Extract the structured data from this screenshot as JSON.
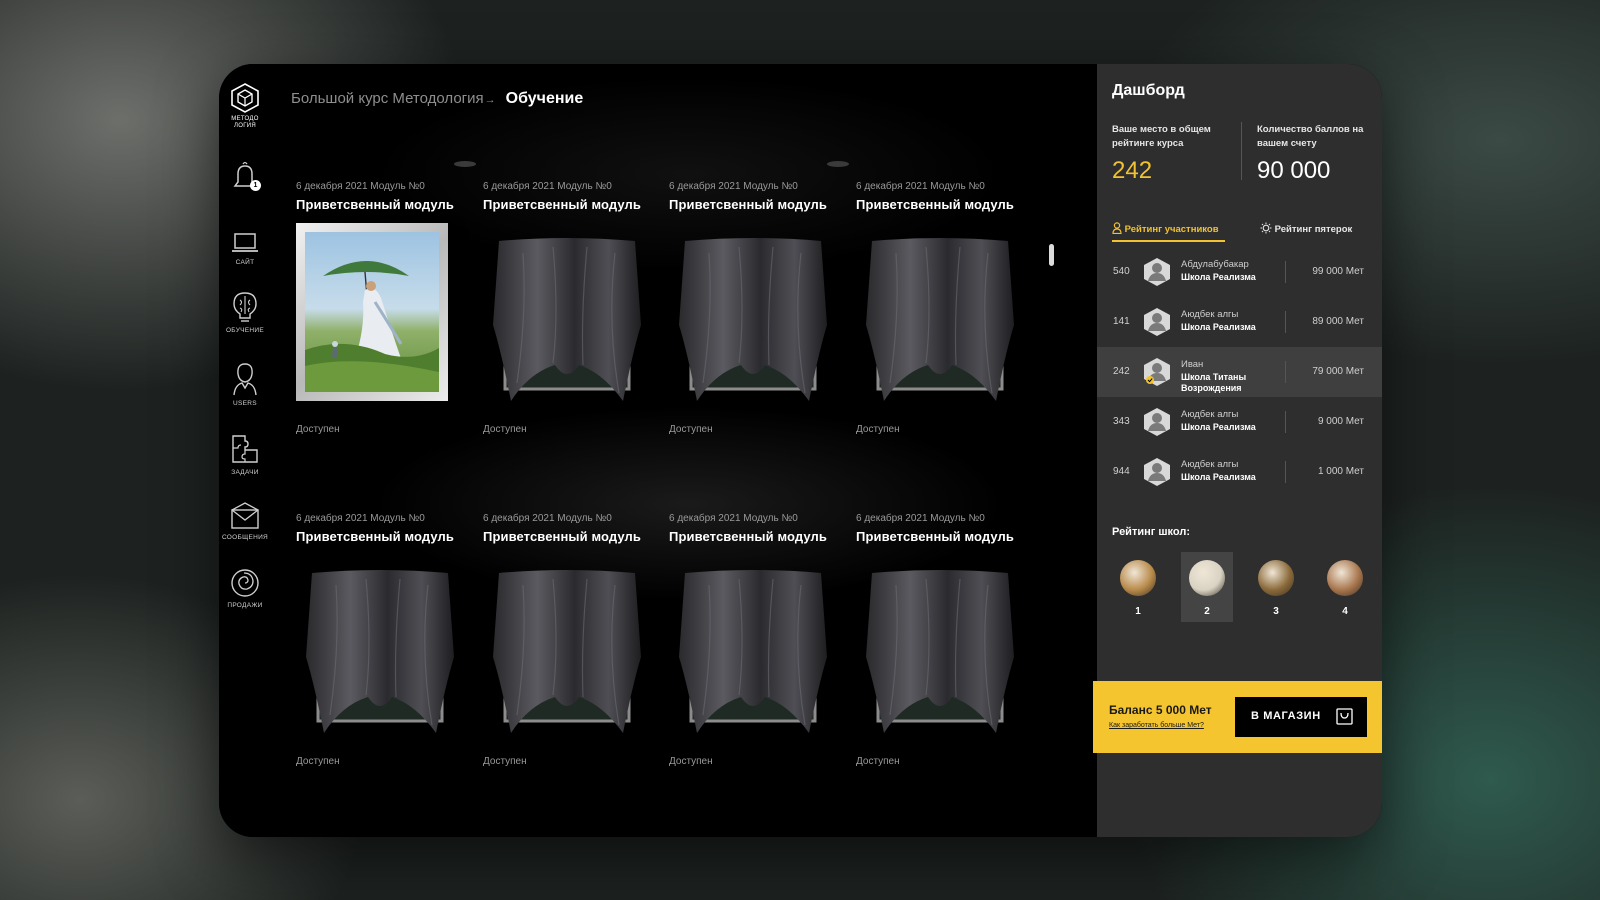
{
  "sidebar": {
    "logo_text": [
      "МЕТОДО",
      "ЛОГИЯ"
    ],
    "bell_badge": "1",
    "items": [
      {
        "label": "САЙТ",
        "icon": "laptop-icon"
      },
      {
        "label": "ОБУЧЕНИЕ",
        "icon": "brain-lightbulb-icon"
      },
      {
        "label": "USERS",
        "icon": "user-icon"
      },
      {
        "label": "ЗАДАЧИ",
        "icon": "puzzle-icon"
      },
      {
        "label": "СООБЩЕНИЯ",
        "icon": "envelope-icon"
      },
      {
        "label": "ПРОДАЖИ",
        "icon": "spiral-icon"
      }
    ]
  },
  "breadcrumb": {
    "parent": "Большой курс Методология",
    "separator": "→",
    "current": "Обучение"
  },
  "modules": [
    {
      "meta": "6 декабря 2021 Модуль №0",
      "title": "Приветсвенный модуль",
      "status": "Доступен",
      "revealed": true
    },
    {
      "meta": "6 декабря 2021 Модуль №0",
      "title": "Приветсвенный модуль",
      "status": "Доступен",
      "revealed": false
    },
    {
      "meta": "6 декабря 2021 Модуль №0",
      "title": "Приветсвенный модуль",
      "status": "Доступен",
      "revealed": false
    },
    {
      "meta": "6 декабря 2021 Модуль №0",
      "title": "Приветсвенный модуль",
      "status": "Доступен",
      "revealed": false
    },
    {
      "meta": "6 декабря 2021 Модуль №0",
      "title": "Приветсвенный модуль",
      "status": "Доступен",
      "revealed": false
    },
    {
      "meta": "6 декабря 2021 Модуль №0",
      "title": "Приветсвенный модуль",
      "status": "Доступен",
      "revealed": false
    },
    {
      "meta": "6 декабря 2021 Модуль №0",
      "title": "Приветсвенный модуль",
      "status": "Доступен",
      "revealed": false
    },
    {
      "meta": "6 декабря 2021 Модуль №0",
      "title": "Приветсвенный модуль",
      "status": "Доступен",
      "revealed": false
    }
  ],
  "dashboard": {
    "title": "Дашборд",
    "rank_label": "Ваше место в общем рейтинге курса",
    "rank_value": "242",
    "points_label": "Количество баллов на вашем счету",
    "points_value": "90 000",
    "tabs": [
      {
        "label": "Рейтинг участников",
        "icon": "person-icon",
        "active": true
      },
      {
        "label": "Рейтинг пятерок",
        "icon": "sun-icon",
        "active": false
      }
    ],
    "leaderboard": [
      {
        "rank": "540",
        "name": "Абдулабубакар",
        "school": "Школа Реализма",
        "points": "99 000 Мет",
        "highlight": false,
        "badge": false
      },
      {
        "rank": "141",
        "name": "Аюдбек алгы",
        "school": "Школа Реализма",
        "points": "89 000 Мет",
        "highlight": false,
        "badge": false
      },
      {
        "rank": "242",
        "name": "Иван",
        "school": "Школа Титаны Возрождения",
        "points": "79 000 Мет",
        "highlight": true,
        "badge": true
      },
      {
        "rank": "343",
        "name": "Аюдбек алгы",
        "school": "Школа Реализма",
        "points": "9 000 Мет",
        "highlight": false,
        "badge": false
      },
      {
        "rank": "944",
        "name": "Аюдбек алгы",
        "school": "Школа Реализма",
        "points": "1 000 Мет",
        "highlight": false,
        "badge": false
      }
    ],
    "schools_title": "Рейтинг школ:",
    "schools": [
      {
        "place": "1",
        "selected": false,
        "color": "#b88a4a"
      },
      {
        "place": "2",
        "selected": true,
        "color": "#d9d3c4"
      },
      {
        "place": "3",
        "selected": false,
        "color": "#8a6a3a"
      },
      {
        "place": "4",
        "selected": false,
        "color": "#a8764e"
      }
    ],
    "balance_text": "Баланс 5 000 Мет",
    "earn_more_link": "Как заработать больше Мет?",
    "shop_button": "В МАГАЗИН",
    "accent_color": "#f2c230"
  }
}
